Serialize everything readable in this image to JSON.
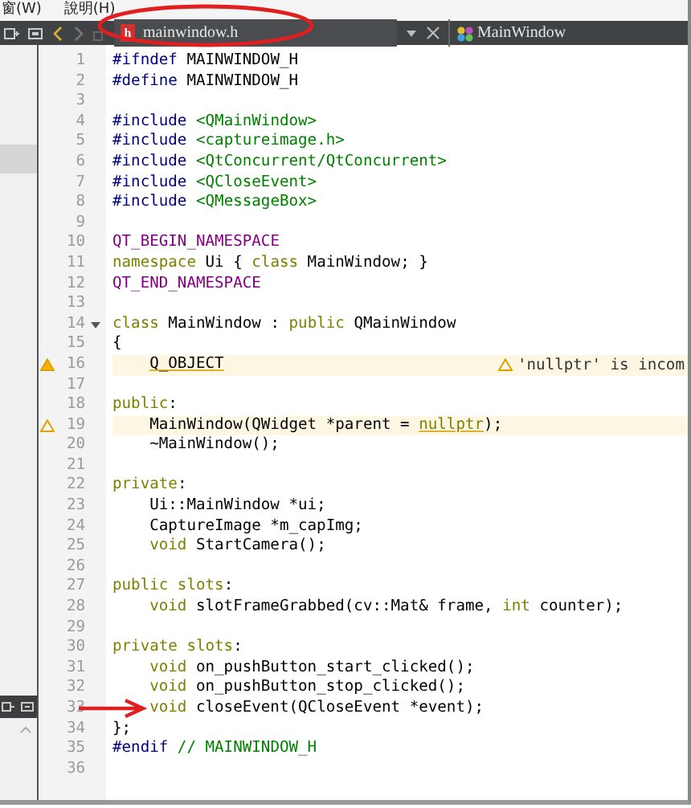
{
  "menu": [
    {
      "label": "窗(W)"
    },
    {
      "label": "說明(H)"
    }
  ],
  "toolbar": {
    "file_tab": {
      "label": "mainwindow.h",
      "file_type": "h"
    },
    "symbol": {
      "label": "MainWindow"
    }
  },
  "editor": {
    "lines": [
      {
        "number": "1",
        "tokens": [
          {
            "kind": "preproc",
            "text": "#ifndef"
          },
          {
            "kind": "plain",
            "text": " MAINWINDOW_H"
          }
        ]
      },
      {
        "number": "2",
        "tokens": [
          {
            "kind": "preproc",
            "text": "#define"
          },
          {
            "kind": "plain",
            "text": " MAINWINDOW_H"
          }
        ]
      },
      {
        "number": "3"
      },
      {
        "number": "4",
        "tokens": [
          {
            "kind": "preproc",
            "text": "#include"
          },
          {
            "kind": "string",
            "text": " <QMainWindow>"
          }
        ]
      },
      {
        "number": "5",
        "tokens": [
          {
            "kind": "preproc",
            "text": "#include"
          },
          {
            "kind": "string",
            "text": " <captureimage.h>"
          }
        ]
      },
      {
        "number": "6",
        "tokens": [
          {
            "kind": "preproc",
            "text": "#include"
          },
          {
            "kind": "string",
            "text": " <QtConcurrent/QtConcurrent>"
          }
        ]
      },
      {
        "number": "7",
        "tokens": [
          {
            "kind": "preproc",
            "text": "#include"
          },
          {
            "kind": "string",
            "text": " <QCloseEvent>"
          }
        ]
      },
      {
        "number": "8",
        "tokens": [
          {
            "kind": "preproc",
            "text": "#include"
          },
          {
            "kind": "string",
            "text": " <QMessageBox>"
          }
        ]
      },
      {
        "number": "9"
      },
      {
        "number": "10",
        "tokens": [
          {
            "kind": "macro",
            "text": "QT_BEGIN_NAMESPACE"
          }
        ]
      },
      {
        "number": "11",
        "tokens": [
          {
            "kind": "keyword",
            "text": "namespace"
          },
          {
            "kind": "plain",
            "text": " Ui { "
          },
          {
            "kind": "keyword",
            "text": "class"
          },
          {
            "kind": "plain",
            "text": " MainWindow; }"
          }
        ]
      },
      {
        "number": "12",
        "tokens": [
          {
            "kind": "macro",
            "text": "QT_END_NAMESPACE"
          }
        ]
      },
      {
        "number": "13"
      },
      {
        "number": "14",
        "fold": true,
        "tokens": [
          {
            "kind": "keyword",
            "text": "class"
          },
          {
            "kind": "plain",
            "text": " MainWindow : "
          },
          {
            "kind": "keyword",
            "text": "public"
          },
          {
            "kind": "plain",
            "text": " QMainWindow"
          }
        ]
      },
      {
        "number": "15",
        "tokens": [
          {
            "kind": "plain",
            "text": "{"
          }
        ]
      },
      {
        "number": "16",
        "warning": true,
        "indented": true,
        "annotation": "'nullptr' is incom",
        "tokens": [
          {
            "kind": "flagged",
            "text": "Q_OBJECT"
          }
        ]
      },
      {
        "number": "17"
      },
      {
        "number": "18",
        "tokens": [
          {
            "kind": "keyword",
            "text": "public"
          },
          {
            "kind": "plain",
            "text": ":"
          }
        ]
      },
      {
        "number": "19",
        "warning": true,
        "indented": true,
        "tokens": [
          {
            "kind": "plain",
            "text": "MainWindow(QWidget *parent = "
          },
          {
            "kind": "flagged-keyword",
            "text": "nullptr"
          },
          {
            "kind": "plain",
            "text": ");"
          }
        ]
      },
      {
        "number": "20",
        "indented": true,
        "tokens": [
          {
            "kind": "plain",
            "text": "~MainWindow();"
          }
        ]
      },
      {
        "number": "21"
      },
      {
        "number": "22",
        "tokens": [
          {
            "kind": "keyword",
            "text": "private"
          },
          {
            "kind": "plain",
            "text": ":"
          }
        ]
      },
      {
        "number": "23",
        "indented": true,
        "tokens": [
          {
            "kind": "plain",
            "text": "Ui::MainWindow *ui;"
          }
        ]
      },
      {
        "number": "24",
        "indented": true,
        "tokens": [
          {
            "kind": "plain",
            "text": "CaptureImage *m_capImg;"
          }
        ]
      },
      {
        "number": "25",
        "indented": true,
        "tokens": [
          {
            "kind": "keyword",
            "text": "void"
          },
          {
            "kind": "plain",
            "text": " StartCamera();"
          }
        ]
      },
      {
        "number": "26"
      },
      {
        "number": "27",
        "tokens": [
          {
            "kind": "keyword",
            "text": "public slots"
          },
          {
            "kind": "plain",
            "text": ":"
          }
        ]
      },
      {
        "number": "28",
        "indented": true,
        "tokens": [
          {
            "kind": "keyword",
            "text": "void"
          },
          {
            "kind": "plain",
            "text": " slotFrameGrabbed(cv::Mat& frame, "
          },
          {
            "kind": "keyword",
            "text": "int"
          },
          {
            "kind": "plain",
            "text": " counter);"
          }
        ]
      },
      {
        "number": "29"
      },
      {
        "number": "30",
        "tokens": [
          {
            "kind": "keyword",
            "text": "private slots"
          },
          {
            "kind": "plain",
            "text": ":"
          }
        ]
      },
      {
        "number": "31",
        "indented": true,
        "tokens": [
          {
            "kind": "keyword",
            "text": "void"
          },
          {
            "kind": "plain",
            "text": " on_pushButton_start_clicked();"
          }
        ]
      },
      {
        "number": "32",
        "indented": true,
        "tokens": [
          {
            "kind": "keyword",
            "text": "void"
          },
          {
            "kind": "plain",
            "text": " on_pushButton_stop_clicked();"
          }
        ]
      },
      {
        "number": "33",
        "marked": true,
        "indented": true,
        "tokens": [
          {
            "kind": "keyword",
            "text": "void"
          },
          {
            "kind": "plain",
            "text": " closeEvent(QCloseEvent *event);"
          }
        ]
      },
      {
        "number": "34",
        "tokens": [
          {
            "kind": "plain",
            "text": "};"
          }
        ]
      },
      {
        "number": "35",
        "tokens": [
          {
            "kind": "preproc",
            "text": "#endif"
          },
          {
            "kind": "comment",
            "text": " // MAINWINDOW_H"
          }
        ]
      },
      {
        "number": "36"
      }
    ]
  },
  "annotations": [
    {
      "kind": "ellipse"
    }
  ]
}
